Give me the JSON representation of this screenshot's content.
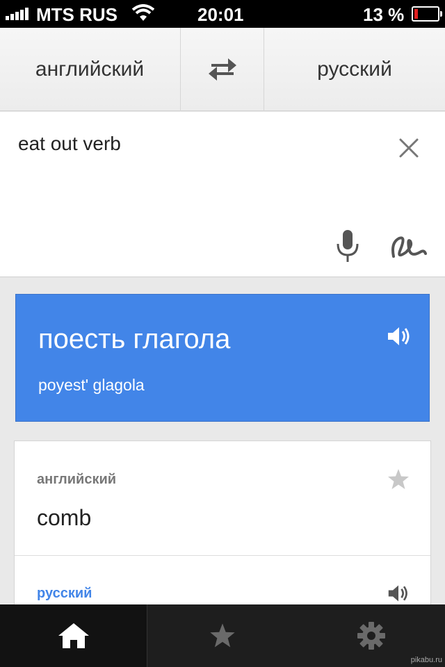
{
  "status_bar": {
    "carrier": "MTS RUS",
    "time": "20:01",
    "battery_percent": "13 %",
    "battery_level": 0.13
  },
  "language_bar": {
    "source_language": "английский",
    "target_language": "русский"
  },
  "input": {
    "text": "eat out verb"
  },
  "translation": {
    "text": "поесть глагола",
    "transliteration": "poyest' glagola"
  },
  "dictionary": {
    "source_language": "английский",
    "word": "comb",
    "target_language": "русский"
  },
  "watermark": "pikabu.ru",
  "colors": {
    "accent": "#4285e8",
    "tab_bar": "#1e1e1e",
    "battery_low": "#e02020"
  },
  "icons": {
    "swap": "swap-arrows-icon",
    "clear": "close-icon",
    "mic": "microphone-icon",
    "handwriting": "handwriting-icon",
    "speaker": "speaker-icon",
    "star": "star-icon",
    "home": "home-icon",
    "settings": "gear-icon"
  }
}
